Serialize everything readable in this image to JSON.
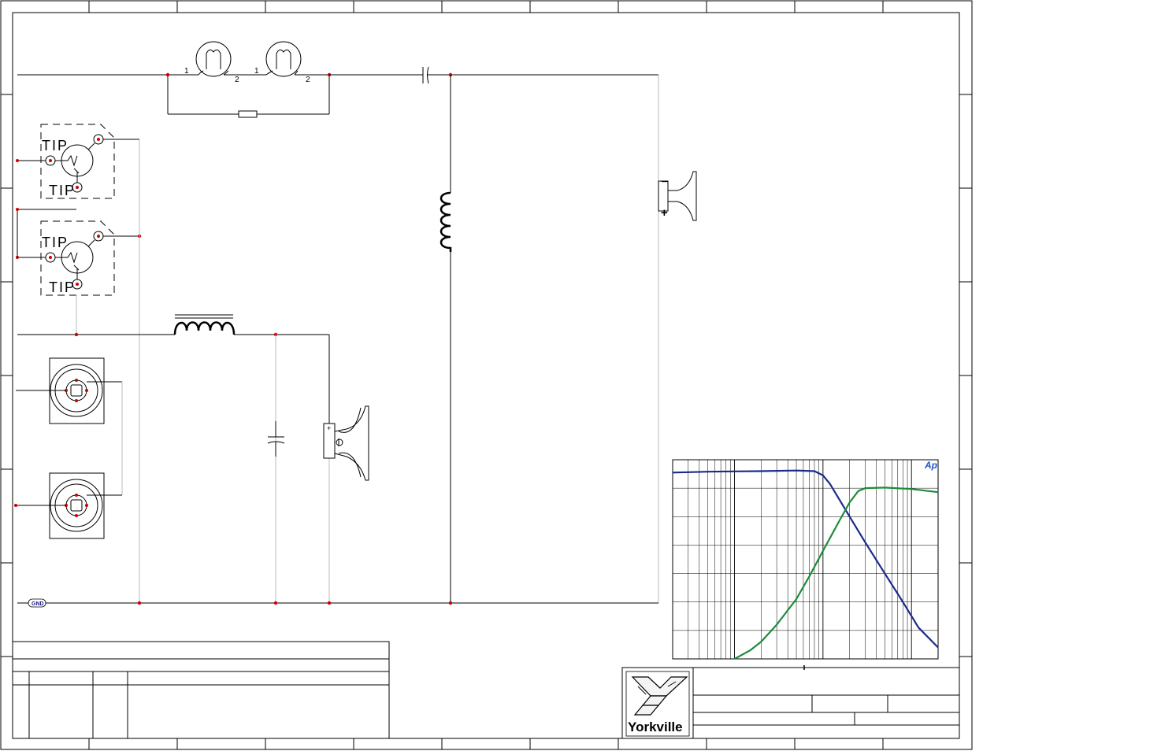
{
  "schematic": {
    "lamp_pins": {
      "pin1": "1",
      "pin2": "2"
    },
    "jack_labels": {
      "tip": "TIP"
    },
    "tweeter_polarity": {
      "minus": "−",
      "plus": "+"
    },
    "ground_label": "GND",
    "logo_text": "Yorkville",
    "graph_badge": "Ap"
  },
  "colors": {
    "wire": "#000000",
    "light_wire": "#bbbbbb",
    "node": "#cc0000",
    "lowpass_curve": "#1a2a8c",
    "highpass_curve": "#1e8c3a",
    "ground_label": "#1a1a8c",
    "badge": "#2255cc"
  },
  "icons": [
    "lamp-icon",
    "resistor-icon",
    "capacitor-icon",
    "inductor-icon",
    "phone-jack-icon",
    "speakon-connector-icon",
    "horn-tweeter-icon",
    "woofer-icon",
    "ground-icon",
    "yorkville-logo-icon"
  ],
  "chart_data": {
    "type": "line",
    "title": "",
    "xlabel": "",
    "ylabel": "",
    "x_scale": "log",
    "xlim": [
      20,
      20000
    ],
    "ylim": [
      -50,
      20
    ],
    "grid": true,
    "series": [
      {
        "x": [
          20,
          50,
          100,
          200,
          500,
          800,
          1000,
          1200,
          1500,
          2000,
          3000,
          5000,
          8000,
          12000,
          20000
        ],
        "y": [
          15.5,
          15.8,
          15.9,
          16.0,
          16.2,
          16.0,
          14.5,
          11.5,
          6.5,
          0,
          -9,
          -20,
          -30,
          -39,
          -46
        ]
      },
      {
        "x": [
          100,
          150,
          200,
          300,
          500,
          700,
          1000,
          1500,
          2000,
          2500,
          3000,
          5000,
          10000,
          20000
        ],
        "y": [
          -50,
          -47,
          -44,
          -38,
          -29,
          -21,
          -12,
          -2,
          5,
          9,
          10,
          10.2,
          9.7,
          8.6
        ]
      }
    ]
  }
}
